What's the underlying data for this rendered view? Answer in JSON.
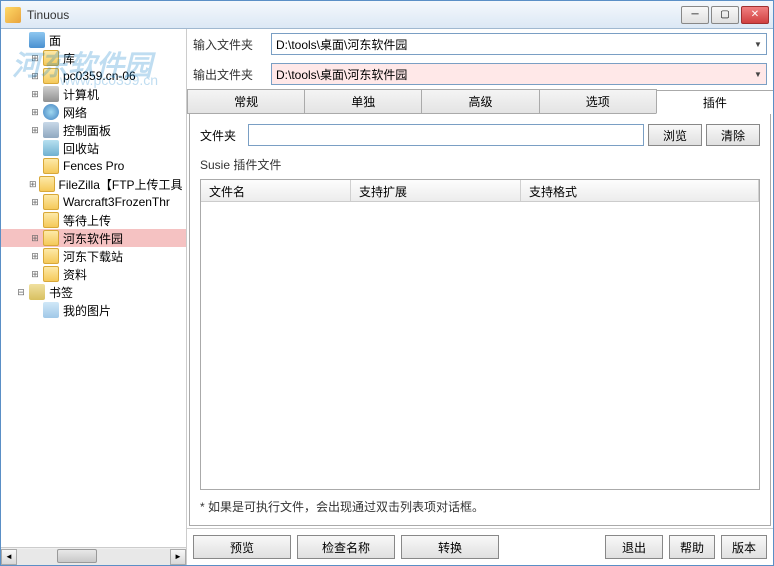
{
  "window": {
    "title": "Tinuous"
  },
  "watermark": {
    "text": "河东软件园",
    "url": "www.pc0359.cn"
  },
  "paths": {
    "input_label": "输入文件夹",
    "output_label": "输出文件夹",
    "input_value": "D:\\tools\\桌面\\河东软件园",
    "output_value": "D:\\tools\\桌面\\河东软件园"
  },
  "tree": [
    {
      "label": "面",
      "indent": 1,
      "expando": "none",
      "icon": "desktop"
    },
    {
      "label": "库",
      "indent": 2,
      "expando": "plus",
      "icon": "folder"
    },
    {
      "label": "pc0359.cn-06",
      "indent": 2,
      "expando": "plus",
      "icon": "folder"
    },
    {
      "label": "计算机",
      "indent": 2,
      "expando": "plus",
      "icon": "computer"
    },
    {
      "label": "网络",
      "indent": 2,
      "expando": "plus",
      "icon": "network"
    },
    {
      "label": "控制面板",
      "indent": 2,
      "expando": "plus",
      "icon": "panel"
    },
    {
      "label": "回收站",
      "indent": 2,
      "expando": "none",
      "icon": "recycle"
    },
    {
      "label": "Fences Pro",
      "indent": 2,
      "expando": "none",
      "icon": "folder"
    },
    {
      "label": "FileZilla【FTP上传工具",
      "indent": 2,
      "expando": "plus",
      "icon": "folder"
    },
    {
      "label": "Warcraft3FrozenThr",
      "indent": 2,
      "expando": "plus",
      "icon": "folder"
    },
    {
      "label": "等待上传",
      "indent": 2,
      "expando": "none",
      "icon": "folder"
    },
    {
      "label": "河东软件园",
      "indent": 2,
      "expando": "plus",
      "icon": "folder",
      "selected": true
    },
    {
      "label": "河东下载站",
      "indent": 2,
      "expando": "plus",
      "icon": "folder"
    },
    {
      "label": "资料",
      "indent": 2,
      "expando": "plus",
      "icon": "folder"
    },
    {
      "label": "书签",
      "indent": 1,
      "expando": "minus",
      "icon": "bookmark"
    },
    {
      "label": "我的图片",
      "indent": 2,
      "expando": "none",
      "icon": "image"
    }
  ],
  "tabs": {
    "items": [
      "常规",
      "单独",
      "高级",
      "选项",
      "插件"
    ],
    "active": 4
  },
  "plugin": {
    "folder_label": "文件夹",
    "browse": "浏览",
    "clear": "清除",
    "subtitle": "Susie 插件文件",
    "cols": [
      "文件名",
      "支持扩展",
      "支持格式"
    ],
    "hint": "* 如果是可执行文件，会出现通过双击列表项对话框。"
  },
  "buttons": {
    "preview": "预览",
    "check_name": "检查名称",
    "convert": "转换",
    "exit": "退出",
    "help": "帮助",
    "version": "版本"
  }
}
